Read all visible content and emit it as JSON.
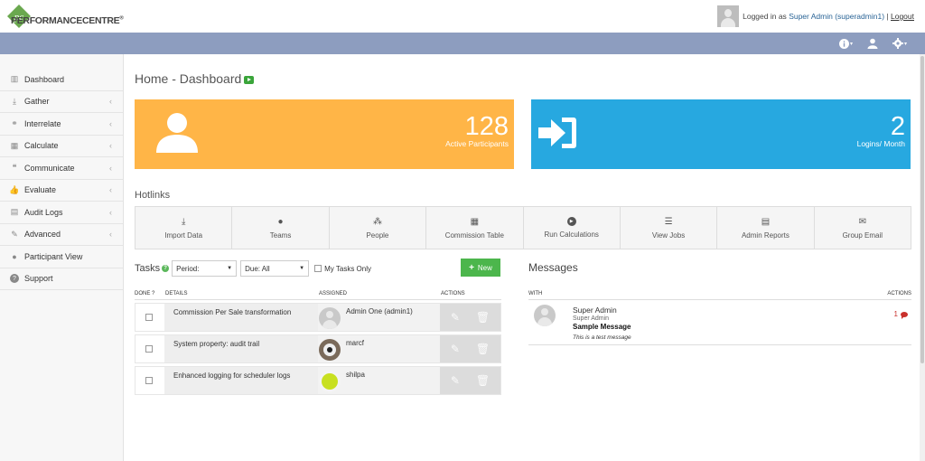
{
  "header": {
    "logo_text": "PERFORMANCECENTRE",
    "logo_reg": "®",
    "logged_in_prefix": "Logged in as",
    "user_display": "Super Admin (superadmin1)",
    "separator": "|",
    "logout_label": "Logout"
  },
  "navbar": {
    "icons": [
      "info-icon",
      "user-icon",
      "gear-icon"
    ]
  },
  "sidebar": {
    "items": [
      {
        "label": "Dashboard",
        "icon": "bar-chart-icon",
        "has_chevron": false
      },
      {
        "label": "Gather",
        "icon": "download-icon",
        "has_chevron": true
      },
      {
        "label": "Interrelate",
        "icon": "link-icon",
        "has_chevron": true
      },
      {
        "label": "Calculate",
        "icon": "table-icon",
        "has_chevron": true
      },
      {
        "label": "Communicate",
        "icon": "comments-icon",
        "has_chevron": true
      },
      {
        "label": "Evaluate",
        "icon": "thumbs-up-icon",
        "has_chevron": true
      },
      {
        "label": "Audit Logs",
        "icon": "file-icon",
        "has_chevron": true
      },
      {
        "label": "Advanced",
        "icon": "wrench-icon",
        "has_chevron": true
      },
      {
        "label": "Participant View",
        "icon": "user-icon",
        "has_chevron": false
      },
      {
        "label": "Support",
        "icon": "question-icon",
        "has_chevron": false
      }
    ]
  },
  "page": {
    "title": "Home - Dashboard"
  },
  "stats": {
    "participants": {
      "value": "128",
      "label": "Active Participants",
      "color": "#ffb547"
    },
    "logins": {
      "value": "2",
      "label": "Logins/ Month",
      "color": "#27a8e0"
    }
  },
  "hotlinks": {
    "title": "Hotlinks",
    "items": [
      {
        "label": "Import Data",
        "icon": "download-icon"
      },
      {
        "label": "Teams",
        "icon": "user-icon"
      },
      {
        "label": "People",
        "icon": "users-icon"
      },
      {
        "label": "Commission Table",
        "icon": "table-icon"
      },
      {
        "label": "Run Calculations",
        "icon": "play-circle-icon"
      },
      {
        "label": "View Jobs",
        "icon": "list-icon"
      },
      {
        "label": "Admin Reports",
        "icon": "report-icon"
      },
      {
        "label": "Group Email",
        "icon": "envelope-icon"
      }
    ]
  },
  "tasks": {
    "title": "Tasks",
    "period_label": "Period:",
    "due_label": "Due: All",
    "my_tasks_label": "My Tasks Only",
    "new_label": "New",
    "columns": {
      "done": "DONE ?",
      "details": "DETAILS",
      "assigned": "ASSIGNED",
      "actions": "ACTIONS"
    },
    "rows": [
      {
        "details": "Commission Per Sale transformation",
        "assigned": "Admin One (admin1)",
        "avatar": "default"
      },
      {
        "details": "System property: audit trail",
        "assigned": "marcf",
        "avatar": "dog"
      },
      {
        "details": "Enhanced logging for scheduler logs",
        "assigned": "shilpa",
        "avatar": "ball"
      }
    ]
  },
  "messages": {
    "title": "Messages",
    "columns": {
      "with": "WITH",
      "actions": "ACTIONS"
    },
    "rows": [
      {
        "sender": "Super Admin",
        "role": "Super Admin",
        "subject": "Sample Message",
        "body": "This is a test message",
        "count": "1"
      }
    ]
  }
}
